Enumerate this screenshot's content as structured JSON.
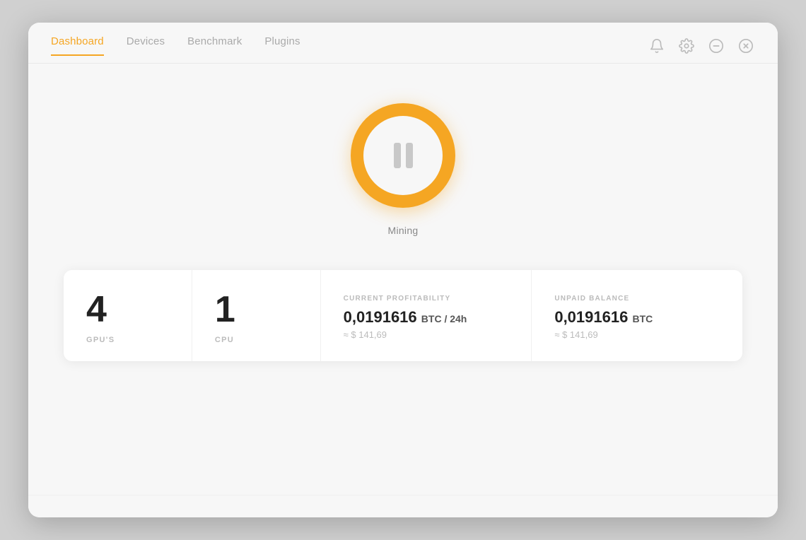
{
  "nav": {
    "tabs": [
      {
        "label": "Dashboard",
        "active": true
      },
      {
        "label": "Devices",
        "active": false
      },
      {
        "label": "Benchmark",
        "active": false
      },
      {
        "label": "Plugins",
        "active": false
      }
    ]
  },
  "window_controls": {
    "notification_icon": "bell",
    "settings_icon": "gear",
    "minimize_icon": "minus",
    "close_icon": "x-circle"
  },
  "mining": {
    "button_state": "paused",
    "label": "Mining"
  },
  "stats": {
    "gpu_count": "4",
    "gpu_label": "GPU'S",
    "cpu_count": "1",
    "cpu_label": "CPU",
    "profitability_label": "CURRENT PROFITABILITY",
    "profitability_value": "0,0191616",
    "profitability_unit": "BTC / 24h",
    "profitability_usd": "≈ $ 141,69",
    "balance_label": "UNPAID BALANCE",
    "balance_value": "0,0191616",
    "balance_unit": "BTC",
    "balance_usd": "≈ $ 141,69"
  },
  "bottom_bar": {
    "text": ""
  }
}
